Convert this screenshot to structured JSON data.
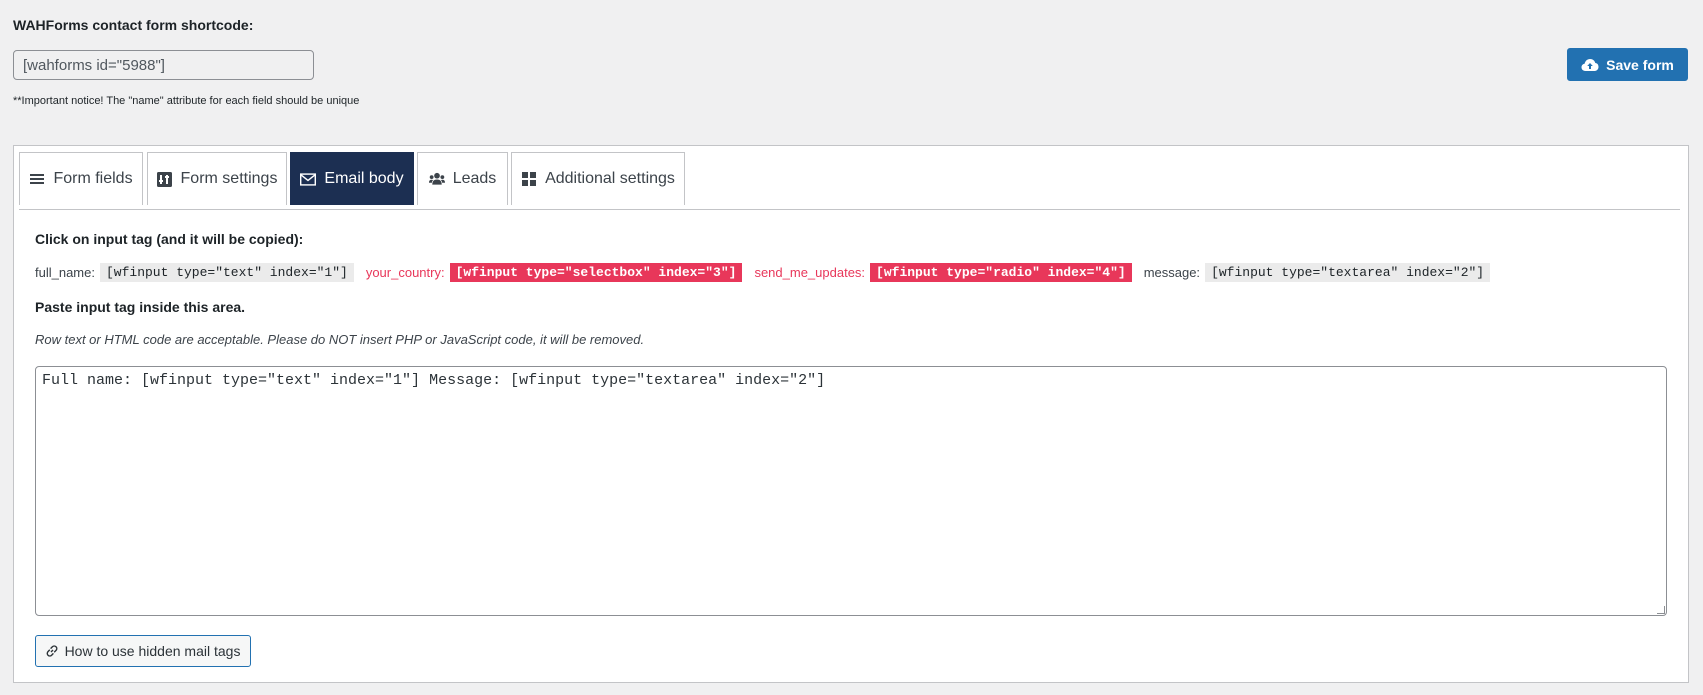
{
  "header": {
    "shortcode_title": "WAHForms contact form shortcode:",
    "shortcode_value": "[wahforms id=\"5988\"]",
    "notice": "**Important notice! The \"name\" attribute for each field should be unique",
    "save_label": "Save form"
  },
  "tabs": [
    {
      "label": "Form fields",
      "icon": "menu-icon"
    },
    {
      "label": "Form settings",
      "icon": "settings-icon"
    },
    {
      "label": "Email body",
      "icon": "envelope-icon",
      "active": true
    },
    {
      "label": "Leads",
      "icon": "users-icon"
    },
    {
      "label": "Additional settings",
      "icon": "grid-icon"
    }
  ],
  "email_body": {
    "click_title": "Click on input tag (and it will be copied):",
    "tags": [
      {
        "label": "full_name:",
        "code": "[wfinput type=\"text\" index=\"1\"]",
        "highlighted": false
      },
      {
        "label": "your_country:",
        "code": "[wfinput type=\"selectbox\" index=\"3\"]",
        "highlighted": true
      },
      {
        "label": "send_me_updates:",
        "code": "[wfinput type=\"radio\" index=\"4\"]",
        "highlighted": true
      },
      {
        "label": "message:",
        "code": "[wfinput type=\"textarea\" index=\"2\"]",
        "highlighted": false
      }
    ],
    "paste_title": "Paste input tag inside this area.",
    "hint": "Row text or HTML code are acceptable. Please do NOT insert PHP or JavaScript code, it will be removed.",
    "body_value": "Full name: [wfinput type=\"text\" index=\"1\"] Message: [wfinput type=\"textarea\" index=\"2\"]",
    "howto_label": "How to use hidden mail tags"
  },
  "colors": {
    "accent": "#2271b1",
    "active_tab": "#1c2f52",
    "highlight": "#e8375a"
  }
}
